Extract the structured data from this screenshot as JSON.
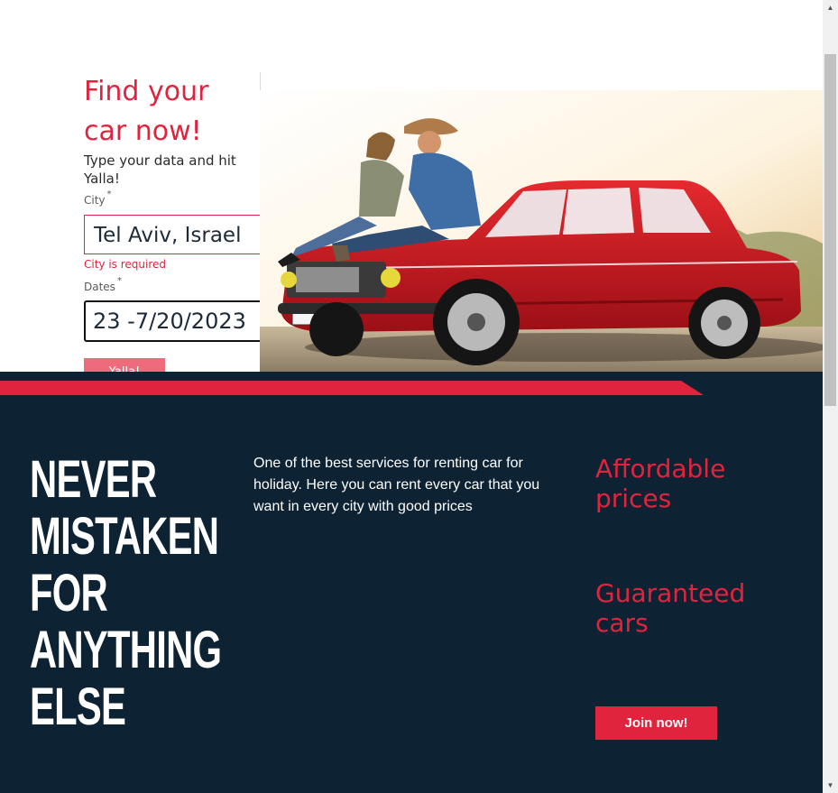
{
  "search": {
    "title_line1": "Find your",
    "title_line2": "car now!",
    "subtitle": "Type your data and hit Yalla!",
    "city_label": "City",
    "city_required_mark": "*",
    "city_value": "Tel Aviv, Israel",
    "city_error": "City is required",
    "dates_label": "Dates",
    "dates_required_mark": "*",
    "dates_value": "23 -7/20/2023",
    "submit_label": "Yalla!"
  },
  "promo": {
    "slogan_lines": [
      "Never",
      "Mistaken",
      "for",
      "anything",
      "else"
    ],
    "description": "One of the best services for renting car for holiday. Here you can rent every car that you want in every city with good prices",
    "feature_1": "Affordable prices",
    "feature_2": "Guaranteed cars",
    "join_label": "Join now!"
  },
  "colors": {
    "accent": "#e0243e",
    "dark": "#0d2233",
    "car_red": "#c4141b"
  },
  "icons": {
    "scroll_up": "▲",
    "scroll_down": "▼"
  }
}
